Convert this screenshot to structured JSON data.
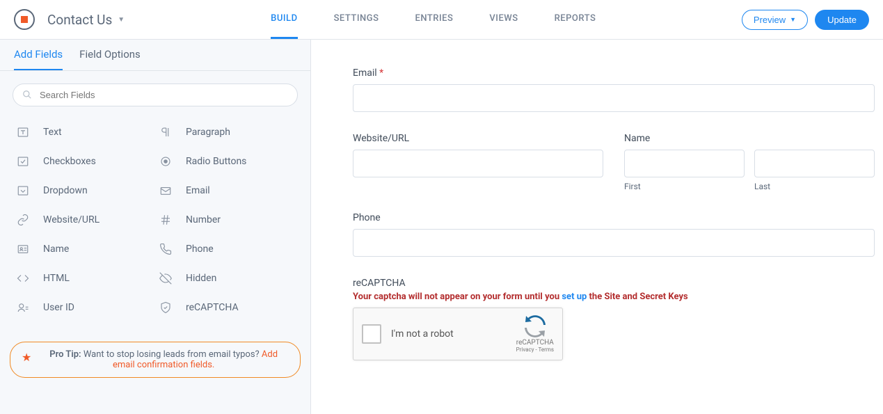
{
  "header": {
    "form_title": "Contact Us",
    "nav": [
      "BUILD",
      "SETTINGS",
      "ENTRIES",
      "VIEWS",
      "REPORTS"
    ],
    "active_nav": 0,
    "preview_label": "Preview",
    "update_label": "Update"
  },
  "sidebar": {
    "tabs": [
      "Add Fields",
      "Field Options"
    ],
    "active_tab": 0,
    "search_placeholder": "Search Fields",
    "fields": [
      {
        "icon": "text",
        "label": "Text"
      },
      {
        "icon": "paragraph",
        "label": "Paragraph"
      },
      {
        "icon": "checkbox",
        "label": "Checkboxes"
      },
      {
        "icon": "radio",
        "label": "Radio Buttons"
      },
      {
        "icon": "dropdown",
        "label": "Dropdown"
      },
      {
        "icon": "email",
        "label": "Email"
      },
      {
        "icon": "link",
        "label": "Website/URL"
      },
      {
        "icon": "number",
        "label": "Number"
      },
      {
        "icon": "name",
        "label": "Name"
      },
      {
        "icon": "phone",
        "label": "Phone"
      },
      {
        "icon": "html",
        "label": "HTML"
      },
      {
        "icon": "hidden",
        "label": "Hidden"
      },
      {
        "icon": "user",
        "label": "User ID"
      },
      {
        "icon": "recaptcha",
        "label": "reCAPTCHA"
      }
    ],
    "pro_tip": {
      "label": "Pro Tip:",
      "text": "Want to stop losing leads from email typos? ",
      "link": "Add email confirmation fields."
    }
  },
  "form": {
    "email": {
      "label": "Email",
      "required": true
    },
    "website": {
      "label": "Website/URL"
    },
    "name": {
      "label": "Name",
      "first": "First",
      "last": "Last"
    },
    "phone": {
      "label": "Phone"
    },
    "recaptcha": {
      "label": "reCAPTCHA",
      "warning_before": "Your captcha will not appear on your form until you ",
      "warning_link": "set up",
      "warning_after": " the Site and Secret Keys",
      "not_robot": "I'm not a robot",
      "brand": "reCAPTCHA",
      "privacy": "Privacy - Terms"
    }
  }
}
